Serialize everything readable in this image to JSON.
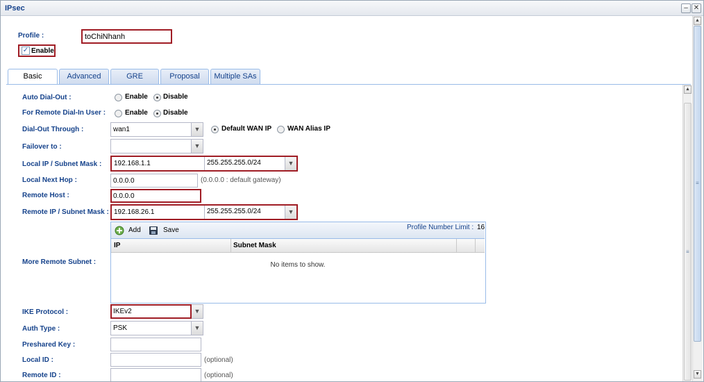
{
  "window": {
    "title": "IPsec"
  },
  "profile": {
    "label": "Profile :",
    "value": "toChiNhanh"
  },
  "enable": {
    "label": "Enable",
    "checked": true
  },
  "tabs": [
    {
      "label": "Basic",
      "active": true
    },
    {
      "label": "Advanced",
      "active": false
    },
    {
      "label": "GRE",
      "active": false
    },
    {
      "label": "Proposal",
      "active": false
    },
    {
      "label": "Multiple SAs",
      "active": false
    }
  ],
  "form": {
    "auto_dial_out": {
      "label": "Auto Dial-Out :",
      "opt_enable": "Enable",
      "opt_disable": "Disable",
      "selected": "Disable"
    },
    "remote_dial_in": {
      "label": "For Remote Dial-In User :",
      "opt_enable": "Enable",
      "opt_disable": "Disable",
      "selected": "Disable"
    },
    "dial_out_through": {
      "label": "Dial-Out Through :",
      "value": "wan1",
      "opt_default": "Default WAN IP",
      "opt_alias": "WAN Alias IP",
      "selected": "Default WAN IP"
    },
    "failover": {
      "label": "Failover to :",
      "value": ""
    },
    "local_ip": {
      "label": "Local IP / Subnet Mask :",
      "ip": "192.168.1.1",
      "mask": "255.255.255.0/24"
    },
    "local_next_hop": {
      "label": "Local Next Hop :",
      "value": "0.0.0.0",
      "note": "(0.0.0.0 : default gateway)"
    },
    "remote_host": {
      "label": "Remote Host :",
      "value": "0.0.0.0"
    },
    "remote_ip": {
      "label": "Remote IP / Subnet Mask :",
      "ip": "192.168.26.1",
      "mask": "255.255.255.0/24"
    },
    "more_remote_subnet": {
      "label": "More Remote Subnet :",
      "add_label": "Add",
      "save_label": "Save",
      "limit_label": "Profile Number Limit :",
      "limit_value": "16",
      "columns": [
        "IP",
        "Subnet Mask"
      ],
      "empty_text": "No items to show."
    },
    "ike_protocol": {
      "label": "IKE Protocol :",
      "value": "IKEv2"
    },
    "auth_type": {
      "label": "Auth Type :",
      "value": "PSK"
    },
    "preshared_key": {
      "label": "Preshared Key :",
      "value": ""
    },
    "local_id": {
      "label": "Local ID :",
      "value": "",
      "note": "(optional)"
    },
    "remote_id": {
      "label": "Remote ID :",
      "value": "",
      "note": "(optional)"
    }
  },
  "colors": {
    "label_blue": "#15428b",
    "highlight": "#a01d25",
    "tab_border": "#99bbe8"
  }
}
